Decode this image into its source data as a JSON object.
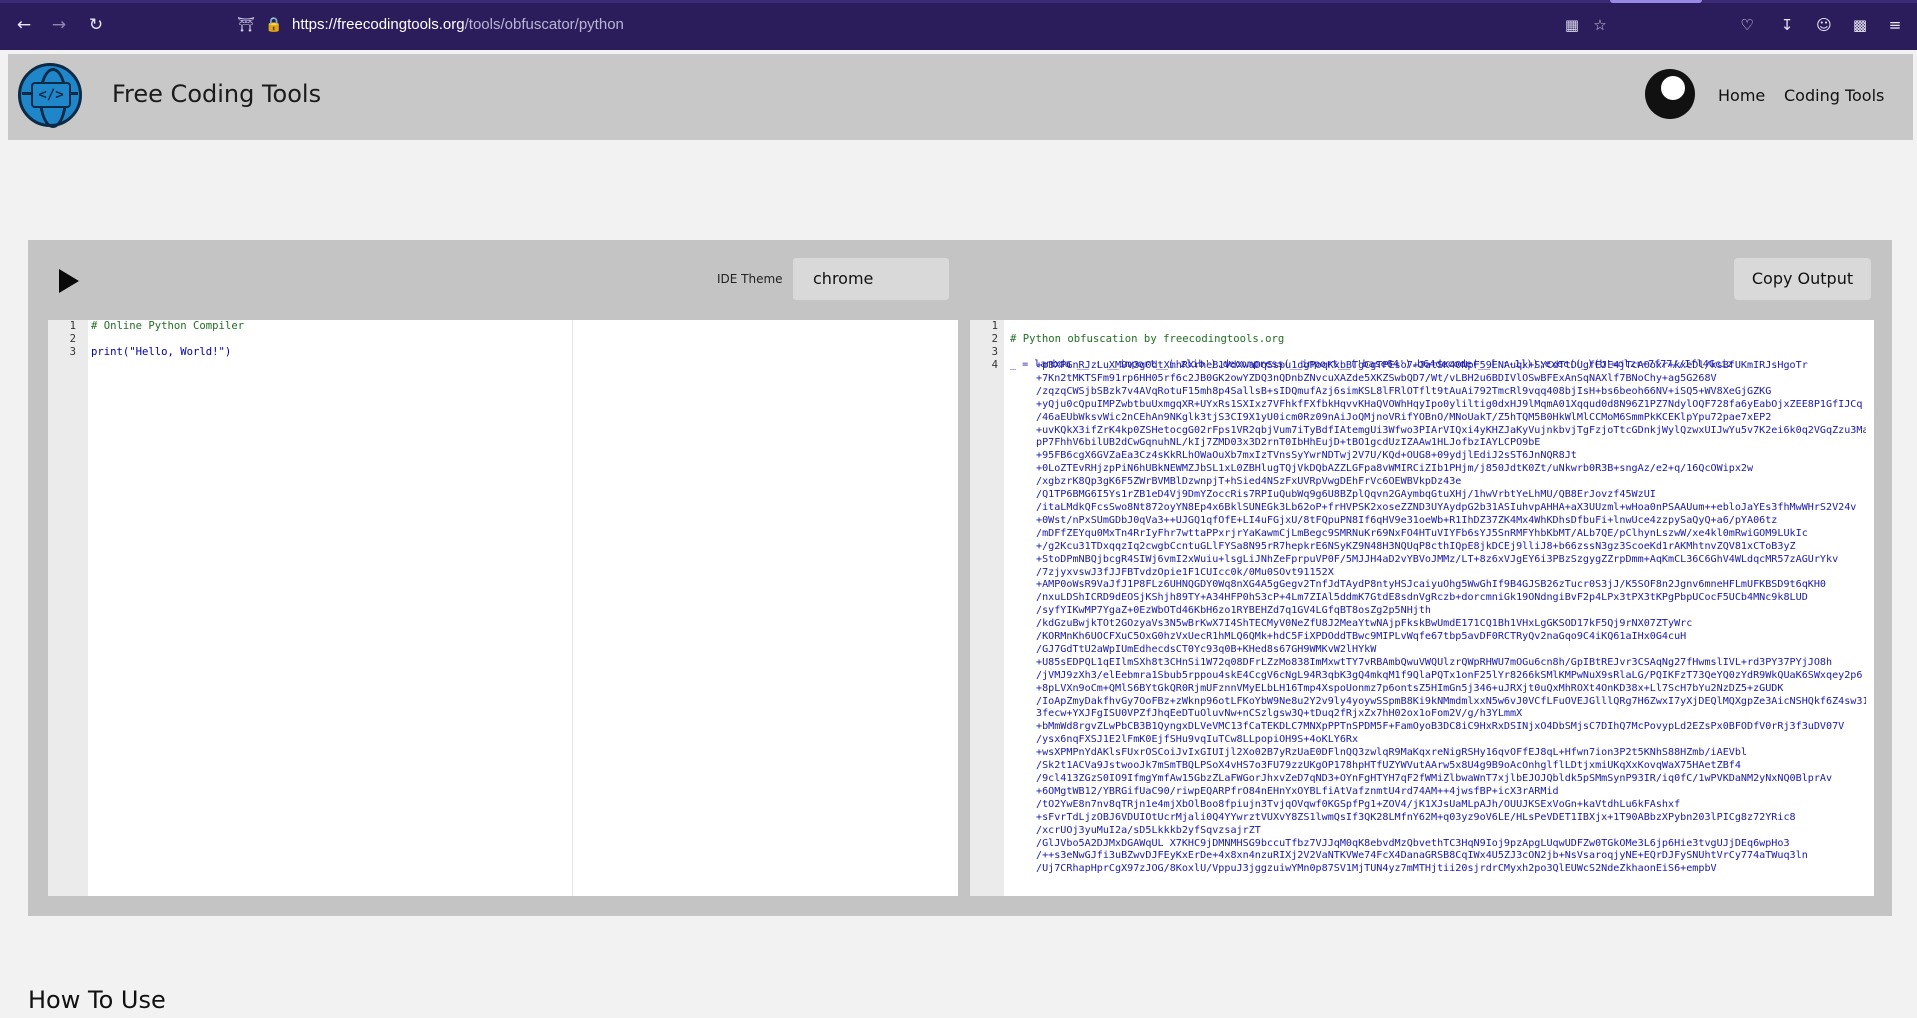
{
  "browser": {
    "url_host": "https://freecodingtools.org",
    "url_path": "/tools/obfuscator/python",
    "icons": [
      "back-icon",
      "forward-icon",
      "reload-icon",
      "shield-icon",
      "lock-icon",
      "translate-icon",
      "star-icon",
      "pocket-icon",
      "download-icon",
      "account-icon",
      "extensions-icon",
      "menu-icon"
    ]
  },
  "site": {
    "title": "Free Coding Tools",
    "nav": {
      "home": "Home",
      "coding_tools": "Coding Tools"
    }
  },
  "tool": {
    "theme_label": "IDE Theme",
    "theme_value": "chrome",
    "copy_label": "Copy Output",
    "input": {
      "line_numbers": [
        "1",
        "2",
        "3"
      ],
      "lines": [
        "# Online Python Compiler",
        "",
        "print(\"Hello, World!\")"
      ]
    },
    "output": {
      "line_numbers": [
        "1",
        "2",
        "3",
        "4"
      ],
      "header_comment": "# Python obfuscation by freecodingtools.org",
      "code_head": "_ = lambda __ : __import__('zlib').decompress(__import__('base64').b64decode(__[::-1]));exec((_)(b'=olzr+7f77//Ifl4Gciz",
      "code_lines": [
        "+p3XPGnRJzLuXM9v3g0dtXmnRXrheB1VdXwaDqSspu1dgPoqKxbBTgCgTPEso7+JatSK40NpF59ENAuqx+SYCdTtDUgfEJE4jTcAOoxr+kxeDl/ksBfUKmIRJsHgoTr",
        "+7Kn2tMKTSFm91rp6HH05rf6c2JB0GK2owYZDQ3nQDnbZNvcuXAZde5XKZSwbQD7/Wt/vLBH2u6BDIVlOSwBFExAnSqNAXlf7BNoChy+ag5G268V",
        "/zqzqCWSjbSBzk7v4AVqRotuF15mh8p4SallsB+sIDQmufAzj6simKSL8lFRlOTflt9tAuAi792TmcRl9vqq408bjIsH+bs6beoh66NV+iSQ5+WV8XeGjGZKG",
        "+yQju0cQpuIMPZwbtbuUxmgqXR+UYxRs1SXIxz7VFhkfFXfbkHqvvKHaQVOWhHqyIpo0yliltig0dxHJ9lMqmA01Xqqud0d8N96Z1PZ7NdylOQF728fa6yEabOjxZEE8P1GfIJCq",
        "/46aEUbWksvWic2nCEhAn9NKglk3tjS3CI9X1yU0icm0Rz09nAiJoQMjnoVRifYOBnO/MNoUakT/Z5hTQM5B0HkWlMlCCMoM6SmmPkKCEKlpYpu72pae7xEP2",
        "+uvKQkX3ifZrK4kp0ZSHetocgG02rFps1VR2qbjVum7iTyBdfIAtemgUi3Wfwo3PIArVIQxi4yKHZJaKyVujnkbvjTgFzjoTtcGDnkjWylQzwxUIJwYu5v7K2ei6k0q2VGqZzu3Ma",
        "pP7FhhV6bilUB2dCwGqnuhNL/kIj7ZMD03x3D2rnT0IbHhEujD+tBO1gcdUzIZAAw1HLJofbzIAYLCPO9bE",
        "+95FB6cgX6GVZaEa3Cz4sKkRLhOWaOuXb7mxIzTVnsSyYwrNDTwj2V7U/KQd+OUG8+09ydjlEdiJ2sST6JnNQR8Jt",
        "+0LoZTEvRHjzpPiN6hUBkNEWMZJbSL1xL0ZBHlugTQjVkDQbAZZLGFpa8vWMIRCiZIb1PHjm/j850JdtK0Zt/uNkwrb0R3B+sngAz/e2+q/16QcOWipx2w",
        "/xgbzrK8Qp3gK6F5ZWrBVMBlDzwnpjT+hSied4NSzFxUVRpVwgDEhFrVc6OEWBVkpDz43e",
        "/Q1TP6BMG6I5Ys1rZB1eD4Vj9DmYZoccRis7RPIuQubWq9g6U8BZplQqvn2GAymbqGtuXHj/1hwVrbtYeLhMU/QB8ErJovzf45WzUI",
        "/itaLMdkQFcsSwo8Nt872oyYN8Ep4x6BklSUNEGk3Lb62oP+frHVPSK2xoseZZND3UYAydpG2b31ASIuhvpAHHA+aX3UUzml+wHoa0nPSAAUum++ebloJaYEs3fhMwWHrS2V24v",
        "+0Wst/nPxSUmGDbJ0qVa3++UJGQ1qfOfE+LI4uFGjxU/8tFQpuPN8If6qHV9e31oeWb+R1IhDZ37ZK4Mx4WhKDhsDfbuFi+lnwUce4zzpySaQyQ+a6/pYA06tz",
        "/mDFfZEYqu0MxTn4RrIyFhr7wttaPPxrjrYaKawmCjLmBegc9SMRNuKr69NxFO4HTuVIYFb6sYJ5SnRMFYhbKbMT/ALb7QE/pClhynLszwW/xe4kl0mRwiGOM9LUkIc",
        "+/g2Kcu31TDxqqzIq2cwgbCcntuGLlFYSa8N95rR7hepkrE6NSyKZ9N48H3NQUqP8cthIQpE8jkDCEj9lliJ8+b66zssN3gz3ScoeKd1rAKMhtnvZQV81xCToB3yZ",
        "+StoDPmNBQjbcgR4SIWj6vmI2xWuiu+lsgLiJNhZeFprpuVP0F/5MJJH4aD2vYBVoJMMz/LT+8z6xVJgEY6i3PBzSzgygZZrpDmm+AqKmCL36C6GhV4WLdqcMR57zAGUrYkv",
        "/7zjyxvswJ3fJJFBTvdzOpie1F1CUIcc0k/0Mu0SOvt91152X",
        "+AMP0oWsR9VaJfJ1P8FLz6UHNQGDY0Wq8nXG4A5gGegv2TnfJdTAydP8ntyHSJcaiyuOhg5WwGhIf9B4GJSB26zTucr0S3jJ/K5SOF8n2Jgnv6mneHFLmUFKBSD9t6qKH0",
        "/nxuLDShICRD9dEOSjKShjh89TY+A34HFP0hS3cP+4Lm7ZIAl5ddmK7GtdE8sdnVgRczb+dorcmniGk19ONdngiBvF2p4LPx3tPX3tKPgPbpUCocF5UCb4MNc9k8LUD",
        "/syfYIKwMP7YgaZ+0EzWbOTd46KbH6zo1RYBEHZd7q1GV4LGfqBT8osZg2p5NHjth",
        "/kdGzuBwjkTOt2GOzyaVs3N5wBrKwX7I4ShTECMyV0NeZfU8J2MeaYtwNAjpFkskBwUmdE171CQ1Bh1VHxLgGKSOD17kF5Qj9rNX07ZTyWrc",
        "/KORMnKh6UOCFXuC5OxG0hzVxUecR1hMLQ6QMk+hdC5FiXPDOddTBwc9MIPLvWqfe67tbp5avDF0RCTRyQv2naGqo9C4iKQ61aIHx0G4cuH",
        "/GJ7GdTtU2aWpIUmEdhecdsCT0Yc93q0B+KHed8s67GH9WMKvW2lHYkW",
        "+U85sEDPQL1qEIlmSXh8t3CHnSi1W72q08DFrLZzMo838ImMxwtTY7vRBAmbQwuVWQUlzrQWpRHWU7mOGu6cn8h/GpIBtREJvr3CSAqNg27fHwmslIVL+rd3PY37PYjJO8h",
        "/jVMJ9zXh3/elEebmra1Sbub5rppou4skE4CcgV6cNgL94R3qbK3gQ4mkqM1f9QlaPQTx1onF25lYr8266kSMlKMPwNuX9sRlaLG/PQIKFzT73QeYQ0zYdR9WkQUaK6SWxqey2p6",
        "+8pLVXn9oCm+QMlS6BYtGkQR0RjmUFznnVMyELbLH16Tmp4XspoUonmz7p6ontsZ5HImGn5j346+uJRXjt0uQxMhROXt4OnKD38x+Ll7ScH7bYu2NzDZ5+zGUDK",
        "/IoApZmyDakfhvGy7OoFBz+zWknp96otLFKoYbW9Ne8u2Y2v9ly4yoywSSpmB8Ki9kNMmdmlxxN5w6vJ0VCfLFuOVEJGlllQRg7H6ZwxI7yXjDEQlMQXgpZe3AicNSHQkf6Z4sw31",
        "3fecw+YXJFgISU0VPZfJhqEeDTuOluvNw+nCSzlgsw3Q+tDuq2fRjxZx7hH02ox1oFom2V/g/h3YLmmX",
        "+bMmWd8rgvZLwPbCB3B1QyngxDLVeVMC13fCaTEKDLC7MNXpPPTnSPDM5F+FamOyoB3DC8iC9HxRxDSINjxO4DbSMjsC7DIhQ7McPovypLd2EZsPx0BFODfV0rRj3f3uDV07V",
        "/ysx6nqFXSJ1E2lFmK0EjfSHu9vqIuTCw8LLpopiOH9S+4oKLY6Rx",
        "+wsXPMPnYdAKlsFUxrOSCoiJvIxGIUIjl2Xo02B7yRzUaE0DFlnQQ3zwlqR9MaKqxreNigRSHy16qvOFfEJ8qL+Hfwn7ion3P2t5KNhS88HZmb/iAEVbl",
        "/Sk2t1ACVa9JstwooJk7mSmTBQLPSoX4vHS7o3FU79zzUKgOP178hpHTfUZYWVutAArw5x8U4g9B9oAcOnhglflLDtjxmiUKqXxKovqWaX75HAetZBf4",
        "/9cl413ZGzS0IO9IfmgYmfAw15GbzZLaFWGorJhxvZeD7qND3+OYnFgHTYH7qF2fWMiZlbwaWnT7xjlbEJOJQbldk5pSMmSynP93IR/iq0fC/1wPVKDaNM2yNxNQ0BlprAv",
        "+6OMgtWB12/YBRGifUaC90/riwpEQARPfrO84nEHnYxOYBLfiAtVafznmtU4rd74AM++4jwsfBP+icX3rARMid",
        "/tO2YwE8n7nv8qTRjn1e4mjXbOlBoo8fpiujn3TvjqOVqwf0KGSpfPg1+ZOV4/jK1XJsUaMLpAJh/OUUJKSExVoGn+kaVtdhLu6kFAshxf",
        "+sFvrTdLjzOBJ6VDUIOtUcrMjali0Q4YYwrztVUXvY8ZS1lwmQsIf3QK28LMfnY62M+q03yz9oV6LE/HLsPeVDET1IBXjx+1T90ABbzXPybn203lPICg8z72YRic8",
        "/xcrUOj3yuMuI2a/sD5Lkkkb2yfSqvzsajrZT",
        "/GlJVbo5A2DJMxDGAWqUL X7KHC9jDMNMHSG9bccuTfbz7VJJqM0qK8ebvdMzQbvethTC3HqN9Ioj9pzApgLUqwUDFZw0TGkOMe3L6jp6Hie3tvgUJjDEq6wpHo3",
        "/++s3eNwGJfi3uBZwvDJFEyKxErDe+4x8xn4nzuRIXj2V2VaNTKVWe74FcX4DanaGRSB8CqIWx4U5ZJ3cON2jb+NsVsaroqjyNE+EQrDJFySNUhtVrCy774aTWuq3ln",
        "/Uj7CRhapHprCgX97zJOG/8KoxlU/VppuJ3jggzuiwYMn0p87SV1MjTUN4yz7mMTHjtii20sjrdrCMyxh2po3QlEUWcS2NdeZkhaonEiS6+empbV"
      ]
    }
  },
  "section": {
    "how_to_use": "How To Use"
  }
}
